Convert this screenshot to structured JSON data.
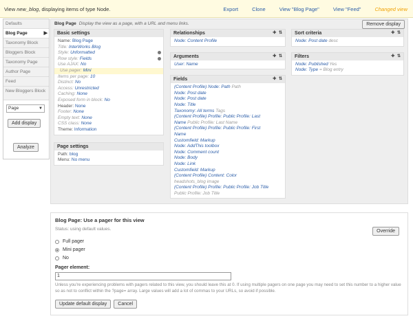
{
  "header": {
    "title_prefix": "View ",
    "view_name": "new_blog",
    "title_suffix": ", displaying items of type Node.",
    "links": [
      "Export",
      "Clone",
      "View \"Blog Page\"",
      "View \"Feed\""
    ],
    "changed": "Changed view"
  },
  "sidebar": {
    "items": [
      "Defaults",
      "Blog Page",
      "Taxonomy Block",
      "Bloggers Block",
      "Taxonomy Page",
      "Author Page",
      "Feed",
      "New Bloggers Block"
    ],
    "select_value": "Page",
    "add_label": "Add display",
    "analyze_label": "Analyze"
  },
  "main": {
    "display_name": "Blog Page",
    "display_desc": "Display the view as a page, with a URL and menu links.",
    "remove_label": "Remove display"
  },
  "basic": {
    "title": "Basic settings",
    "rows": [
      {
        "k": "Name:",
        "v": "Blog Page"
      },
      {
        "k": "Title:",
        "v": "InterWorks Blog"
      },
      {
        "k": "Style:",
        "v": "Unformatted"
      },
      {
        "k": "Row style:",
        "v": "Fields"
      },
      {
        "k": "Use AJAX:",
        "v": "No"
      },
      {
        "k": "Use pager:",
        "v": "Mini"
      },
      {
        "k": "Items per page:",
        "v": "10"
      },
      {
        "k": "Distinct:",
        "v": "No"
      },
      {
        "k": "Access:",
        "v": "Unrestricted"
      },
      {
        "k": "Caching:",
        "v": "None"
      },
      {
        "k": "Exposed form in block:",
        "v": "No"
      },
      {
        "k": "Header:",
        "v": "None"
      },
      {
        "k": "Footer:",
        "v": "None"
      },
      {
        "k": "Empty text:",
        "v": "None"
      },
      {
        "k": "CSS class:",
        "v": "None"
      },
      {
        "k": "Theme:",
        "v": "Information"
      }
    ]
  },
  "page_settings": {
    "title": "Page settings",
    "rows": [
      {
        "k": "Path:",
        "v": "blog"
      },
      {
        "k": "Menu:",
        "v": "No menu"
      }
    ]
  },
  "relationships": {
    "title": "Relationships",
    "items": [
      "Node: Content Profile"
    ]
  },
  "arguments": {
    "title": "Arguments",
    "items": [
      "User: Name"
    ]
  },
  "fields": {
    "title": "Fields",
    "items": [
      {
        "text": "(Content Profile) Node: Path",
        "label": "Path"
      },
      {
        "text": "Node: Post date",
        "label": ""
      },
      {
        "text": "Node: Post date",
        "label": ""
      },
      {
        "text": "Node: Title",
        "label": ""
      },
      {
        "text": "Taxonomy: All terms",
        "label": "Tags"
      },
      {
        "text": "(Content Profile) Profile: Public Profile: Last",
        "label": ""
      },
      {
        "text": "Name",
        "label": "Public Profile: Last Name"
      },
      {
        "text": "(Content Profile) Profile: Public Profile: First",
        "label": ""
      },
      {
        "text": "Name",
        "label": ""
      },
      {
        "text": "Customfield: Markup",
        "label": ""
      },
      {
        "text": "Node: AddThis toolbox",
        "label": ""
      },
      {
        "text": "Node: Comment count",
        "label": ""
      },
      {
        "text": "Node: Body",
        "label": ""
      },
      {
        "text": "Node: Link",
        "label": ""
      },
      {
        "text": "Customfield: Markup",
        "label": ""
      },
      {
        "text": "(Content Profile) Content: Color",
        "label": ""
      },
      {
        "text": "headshots_blog image",
        "label": ""
      },
      {
        "text": "(Content Profile) Profile: Public Profile: Job Title",
        "label": ""
      },
      {
        "text": "Public Profile: Job Title",
        "label": ""
      }
    ]
  },
  "sort": {
    "title": "Sort criteria",
    "items": [
      {
        "text": "Node: Post date",
        "label": "desc"
      }
    ]
  },
  "filters": {
    "title": "Filters",
    "items": [
      {
        "text": "Node: Published",
        "label": "Yes"
      },
      {
        "text": "Node: Type",
        "label": "= Blog entry"
      }
    ]
  },
  "edit": {
    "title": "Blog Page: Use a pager for this view",
    "status": "Status: using default values.",
    "override_label": "Override",
    "options": [
      "Full pager",
      "Mini pager",
      "No"
    ],
    "selected_index": 1,
    "pager_element_label": "Pager element:",
    "pager_element_value": "1",
    "description": "Unless you're experiencing problems with pagers related to this view, you should leave this at 0. If using multiple pagers on one page you may need to set this number to a higher value so as not to conflict within the ?page= array. Large values will add a lot of commas to your URLs, so avoid if possible.",
    "update_label": "Update default display",
    "cancel_label": "Cancel"
  }
}
